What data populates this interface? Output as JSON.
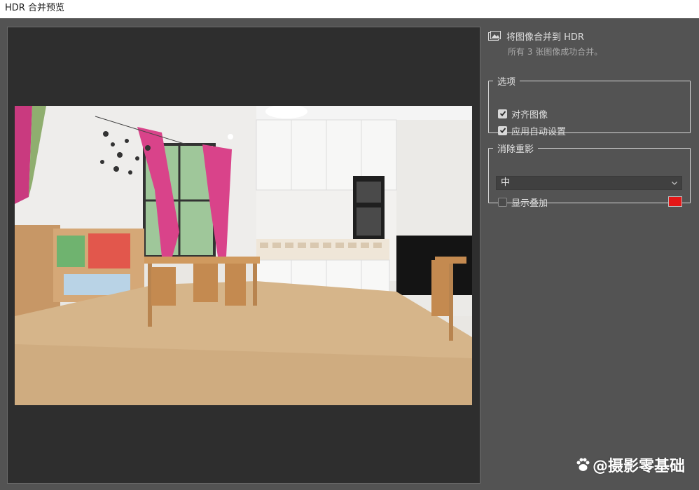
{
  "window": {
    "title": "HDR 合并预览"
  },
  "result": {
    "heading": "将图像合并到 HDR",
    "subtext": "所有 3 张图像成功合并。"
  },
  "options": {
    "legend": "选项",
    "align_label": "对齐图像",
    "align_checked": true,
    "auto_label": "应用自动设置",
    "auto_checked": true
  },
  "deghost": {
    "legend": "消除重影",
    "selected": "中",
    "overlay_label": "显示叠加",
    "overlay_checked": false,
    "overlay_color": "#e51717"
  },
  "watermark": {
    "text": "@摄影零基础"
  }
}
